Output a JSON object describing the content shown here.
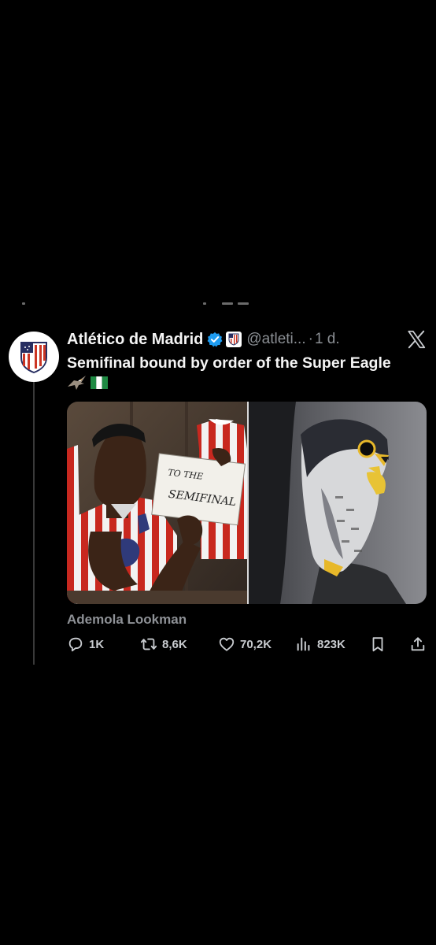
{
  "tweet": {
    "display_name": "Atlético de Madrid",
    "handle": "@atleti...",
    "separator": "·",
    "time": "1 d.",
    "text": "Semifinal bound by order of the Super Eagle",
    "emojis": [
      "eagle",
      "nigeria-flag"
    ],
    "sign_text_line1": "TO THE",
    "sign_text_line2": "SEMIFINAL",
    "image_caption": "Ademola Lookman"
  },
  "actions": {
    "replies": "1K",
    "reposts": "8,6K",
    "likes": "70,2K",
    "views": "823K"
  },
  "icons": {
    "verified": "verified-badge-icon",
    "x": "x-logo-icon",
    "reply": "reply-icon",
    "repost": "repost-icon",
    "like": "heart-icon",
    "views": "views-icon",
    "bookmark": "bookmark-icon",
    "share": "share-icon"
  },
  "colors": {
    "background": "#000000",
    "verified_blue": "#1d9bf0",
    "atletico_red": "#cb3524",
    "atletico_blue": "#272e61",
    "muted_text": "#8b8f94"
  }
}
